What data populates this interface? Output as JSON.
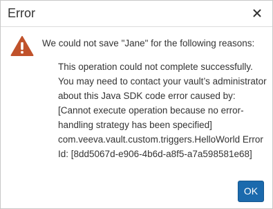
{
  "dialog": {
    "title": "Error",
    "close_icon": "close-icon",
    "warning_icon": "warning-triangle-icon",
    "warning_color": "#c0522b",
    "headline": "We could not save \"Jane\" for the following reasons:",
    "detail_lines": [
      "This operation could not complete successfully.",
      "You may need to contact your vault’s administrator",
      "about this Java SDK code error caused by:",
      "[Cannot execute operation because no error-",
      "handling strategy has been specified]",
      "com.veeva.vault.custom.triggers.HelloWorld Error",
      "Id: [8dd5067d-e906-4b6d-a8f5-a7a598581e68]"
    ],
    "ok_label": "OK",
    "ok_color": "#1b6aad"
  }
}
